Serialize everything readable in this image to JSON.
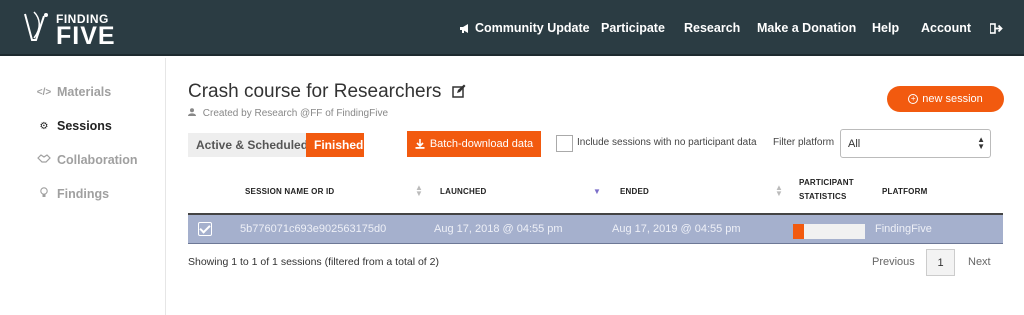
{
  "brand": {
    "logo_top": "FINDING",
    "logo_bottom": "FIVE"
  },
  "nav": {
    "community": "Community Update",
    "participate": "Participate",
    "research": "Research",
    "donation": "Make a Donation",
    "help": "Help",
    "account": "Account"
  },
  "sidebar": {
    "items": [
      {
        "label": "Materials",
        "icon": "code-icon",
        "active": false
      },
      {
        "label": "Sessions",
        "icon": "cogs-icon",
        "active": true
      },
      {
        "label": "Collaboration",
        "icon": "handshake-icon",
        "active": false
      },
      {
        "label": "Findings",
        "icon": "lightbulb-icon",
        "active": false
      }
    ]
  },
  "page": {
    "title": "Crash course for Researchers",
    "subtitle": "Created by Research @FF of FindingFive"
  },
  "toolbar": {
    "new_session": "new session",
    "tab_active": "Active & Scheduled",
    "tab_finished": "Finished",
    "batch_download": "Batch-download data",
    "include_empty": "Include sessions with no participant data",
    "include_empty_checked": false,
    "filter_label": "Filter platform",
    "filter_value": "All"
  },
  "table": {
    "headers": {
      "session": "Session name or ID",
      "launched": "Launched",
      "ended": "Ended",
      "stats_line1": "Participant",
      "stats_line2": "Statistics",
      "platform": "Platform"
    },
    "sorted_column": "launched",
    "rows": [
      {
        "selected": true,
        "session_id": "5b776071c693e902563175d0",
        "launched": "Aug 17, 2018 @ 04:55 pm",
        "ended": "Aug 17, 2019 @ 04:55 pm",
        "participant_fraction": 0.15,
        "platform": "FindingFive"
      }
    ]
  },
  "footer": {
    "showing": "Showing 1 to 1 of 1 sessions (filtered from a total of 2)",
    "prev": "Previous",
    "page": "1",
    "next": "Next"
  },
  "colors": {
    "accent": "#f25a0f",
    "topbar": "#2b3c43",
    "selected_row": "#a5b0cd"
  }
}
